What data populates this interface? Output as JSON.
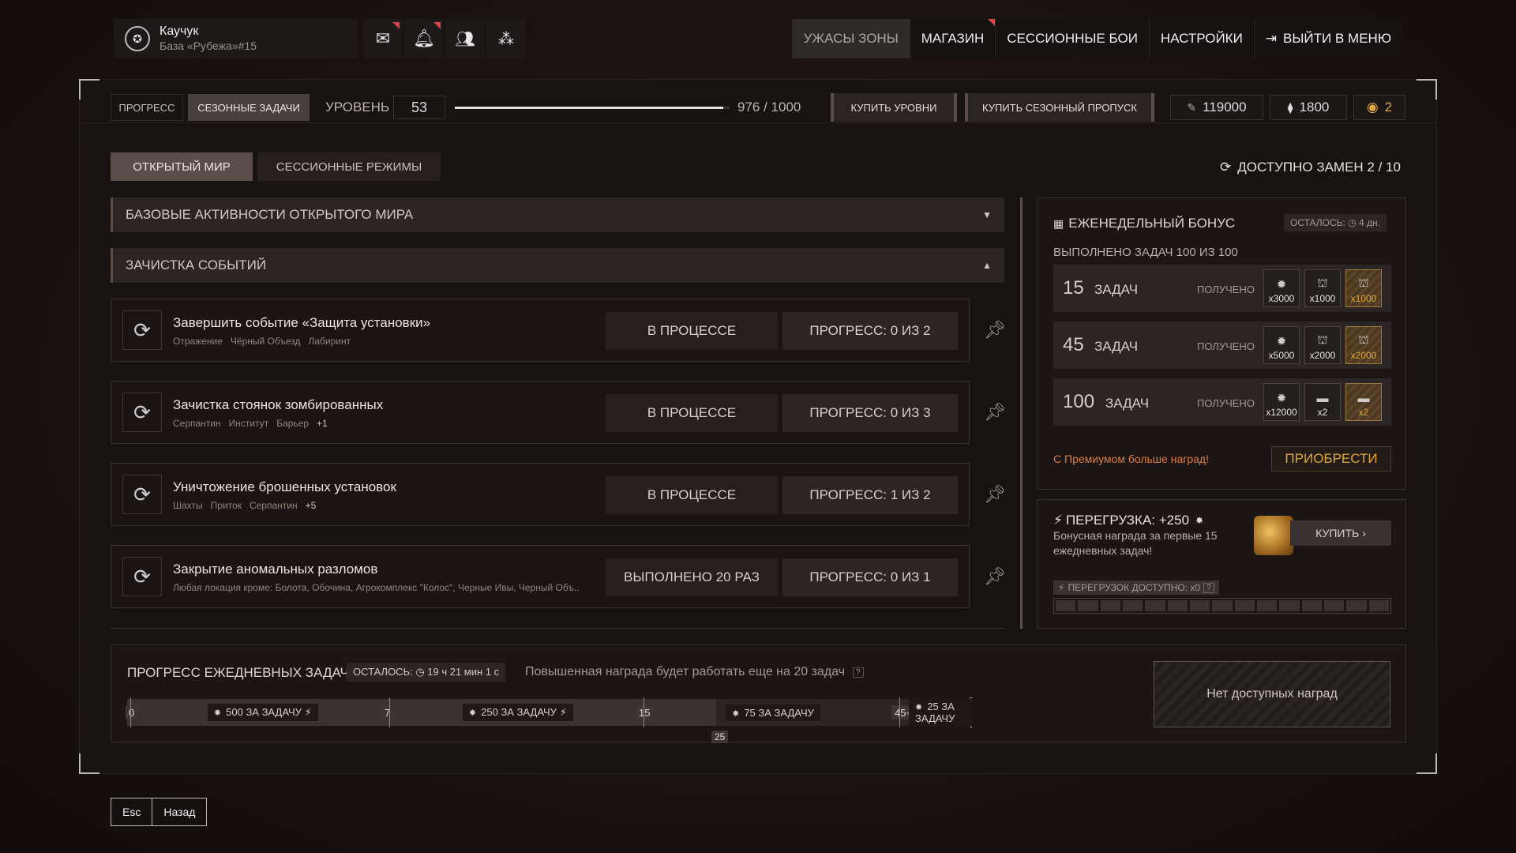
{
  "profile": {
    "name": "Каучук",
    "base": "База «Рубежа»#15"
  },
  "nav": [
    "УЖАСЫ ЗОНЫ",
    "МАГАЗИН",
    "СЕССИОННЫЕ БОИ",
    "НАСТРОЙКИ",
    "ВЫЙТИ В МЕНЮ"
  ],
  "topbar": {
    "tab_progress": "ПРОГРЕСС",
    "tab_season": "СЕЗОННЫЕ ЗАДАЧИ",
    "level_label": "УРОВЕНЬ",
    "level": "53",
    "xp": "976 / 1000",
    "xp_fraction": 0.976,
    "buy_levels": "КУПИТЬ УРОВНИ",
    "buy_pass": "КУПИТЬ СЕЗОННЫЙ ПРОПУСК",
    "cur1": "119000",
    "cur2": "1800",
    "cur3": "2"
  },
  "modes": {
    "open": "ОТКРЫТЫЙ МИР",
    "session": "СЕССИОННЫЕ РЕЖИМЫ",
    "swaps": "ДОСТУПНО ЗАМЕН 2 / 10"
  },
  "acc1": "БАЗОВЫЕ АКТИВНОСТИ ОТКРЫТОГО МИРА",
  "acc2": "ЗАЧИСТКА СОБЫТИЙ",
  "tasks": [
    {
      "title": "Завершить событие «Защита установки»",
      "locs": [
        "Отражение",
        "Чёрный Объезд",
        "Лабиринт"
      ],
      "more": "",
      "status": "В ПРОЦЕССЕ",
      "progress": "ПРОГРЕСС: 0 ИЗ 2"
    },
    {
      "title": "Зачистка стоянок зомбированных",
      "locs": [
        "Серпантин",
        "Институт",
        "Барьер"
      ],
      "more": "+1",
      "status": "В ПРОЦЕССЕ",
      "progress": "ПРОГРЕСС: 0 ИЗ 3"
    },
    {
      "title": "Уничтожение брошенных установок",
      "locs": [
        "Шахты",
        "Приток",
        "Серпантин"
      ],
      "more": "+5",
      "status": "В ПРОЦЕССЕ",
      "progress": "ПРОГРЕСС: 1 ИЗ 2"
    },
    {
      "title": "Закрытие аномальных разломов",
      "locs": [
        "Любая локация кроме: Болота, Обочина, Агрокомплекс \"Колос\", Черные Ивы, Черный Объ.."
      ],
      "more": "",
      "status": "ВЫПОЛНЕНО 20 РАЗ",
      "progress": "ПРОГРЕСС: 0 ИЗ 1"
    }
  ],
  "weekly": {
    "title": "ЕЖЕНЕДЕЛЬНЫЙ БОНУС",
    "left": "ОСТАЛОСЬ: ◷ 4 дн.",
    "done": "ВЫПОЛНЕНО ЗАДАЧ 100 ИЗ 100",
    "word": "ЗАДАЧ",
    "got": "ПОЛУЧЕНО",
    "rows": [
      {
        "n": "15",
        "r": [
          "x3000",
          "x1000",
          "x1000"
        ]
      },
      {
        "n": "45",
        "r": [
          "x5000",
          "x2000",
          "x2000"
        ]
      },
      {
        "n": "100",
        "r": [
          "x12000",
          "x2",
          "x2"
        ]
      }
    ],
    "premium": "С Премиумом больше наград!",
    "buy": "ПРИОБРЕСТИ"
  },
  "overload": {
    "title": "ПЕРЕГРУЗКА: +250",
    "desc1": "Бонусная награда за первые 15",
    "desc2": "ежедневных задач!",
    "buy": "КУПИТЬ",
    "avail": "ПЕРЕГРУЗОК ДОСТУПНО: x0",
    "cells": 15
  },
  "daily": {
    "title": "ПРОГРЕСС ЕЖЕДНЕВНЫХ ЗАДАЧ",
    "left": "ОСТАЛОСЬ: ◷ 19 ч 21 мин 1 с",
    "note": "Повышенная награда будет работать еще на 20 задач",
    "noreward": "Нет доступных наград",
    "marks": [
      "0",
      "7",
      "15",
      "45+"
    ],
    "segs": [
      "500 ЗА ЗАДАЧУ",
      "250 ЗА ЗАДАЧУ",
      "75 ЗА ЗАДАЧУ",
      "25 ЗА ЗАДАЧУ"
    ],
    "current": "25"
  },
  "footer": {
    "esc": "Esc",
    "back": "Назад"
  }
}
